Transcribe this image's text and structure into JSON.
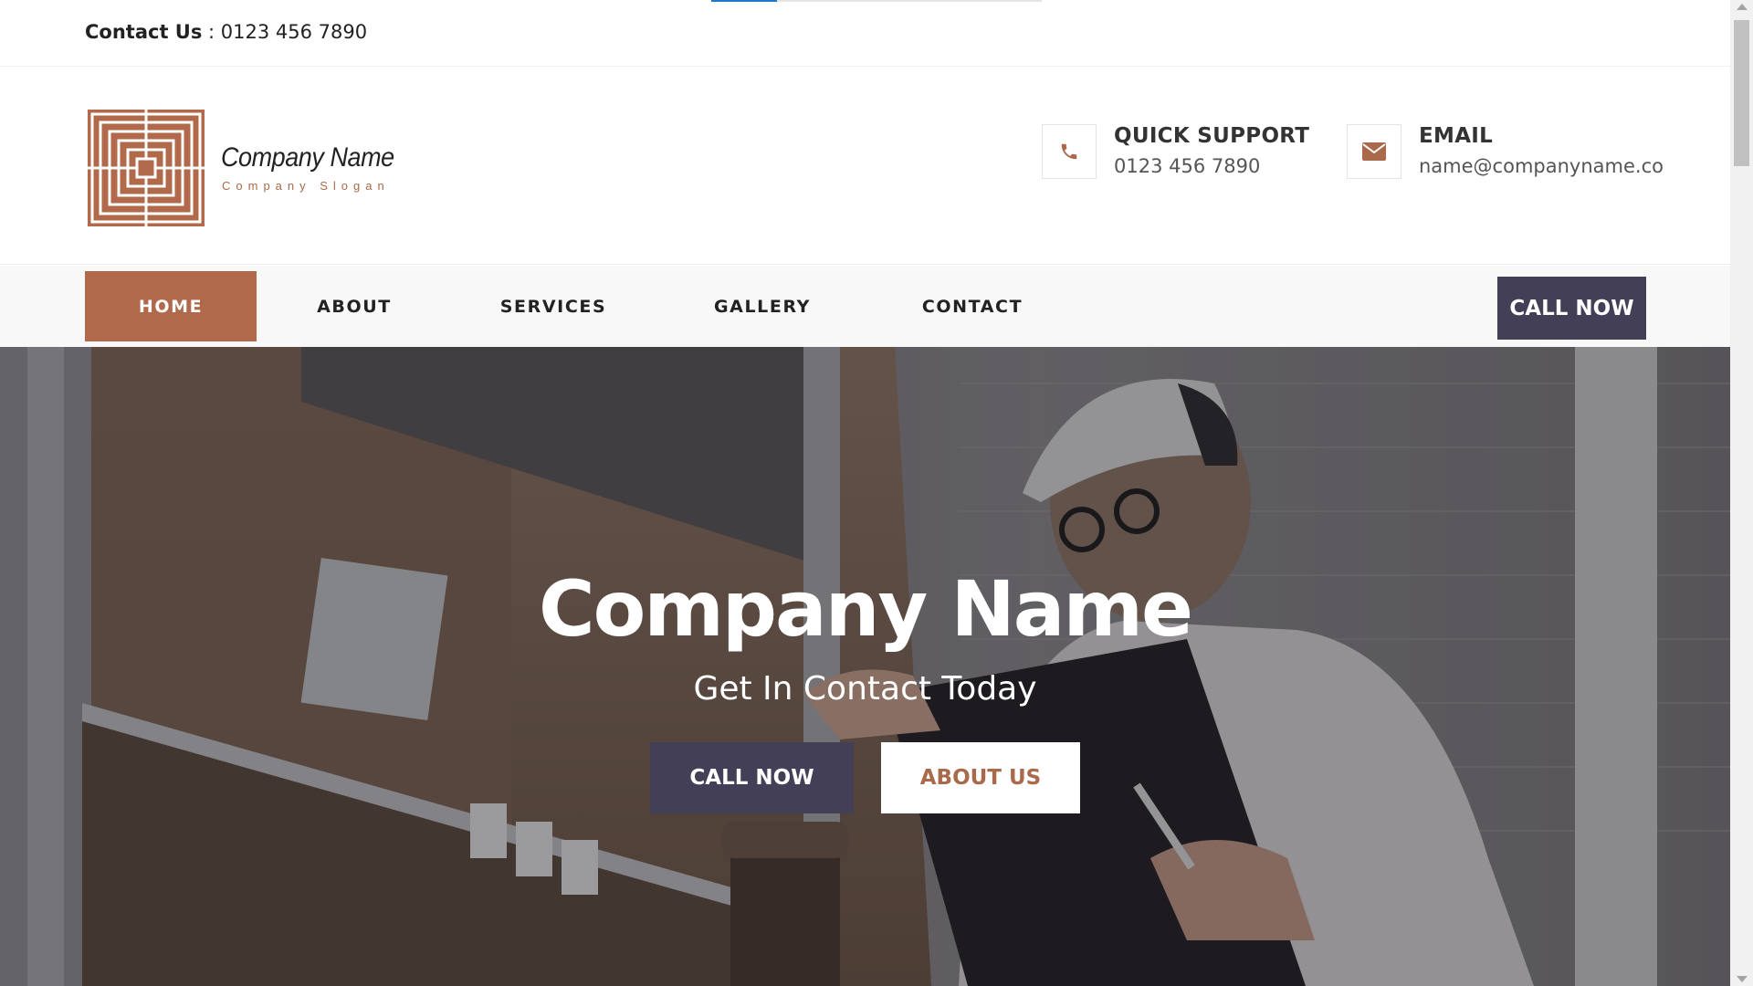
{
  "loading": {
    "progress": 0.2
  },
  "topbar": {
    "contact_label": "Contact Us",
    "contact_sep": " : ",
    "contact_phone": "0123 456 7890"
  },
  "brand": {
    "name": "Company Name",
    "slogan": "Company Slogan",
    "logo_color": "#b0694a"
  },
  "header": {
    "support": {
      "icon": "phone-icon",
      "title": "QUICK SUPPORT",
      "value": "0123 456 7890"
    },
    "email": {
      "icon": "envelope-icon",
      "title": "EMAIL",
      "value": "name@companyname.co"
    }
  },
  "nav": {
    "items": [
      {
        "label": "HOME",
        "active": true
      },
      {
        "label": "ABOUT",
        "active": false
      },
      {
        "label": "SERVICES",
        "active": false
      },
      {
        "label": "GALLERY",
        "active": false
      },
      {
        "label": "CONTACT",
        "active": false
      }
    ],
    "call_label": "CALL NOW"
  },
  "hero": {
    "title": "Company Name",
    "subtitle": "Get In Contact Today",
    "primary_label": "CALL NOW",
    "secondary_label": "ABOUT US"
  },
  "colors": {
    "accent": "#b0694a",
    "dark": "#433f56",
    "nav_bg": "#f8f8f8"
  }
}
